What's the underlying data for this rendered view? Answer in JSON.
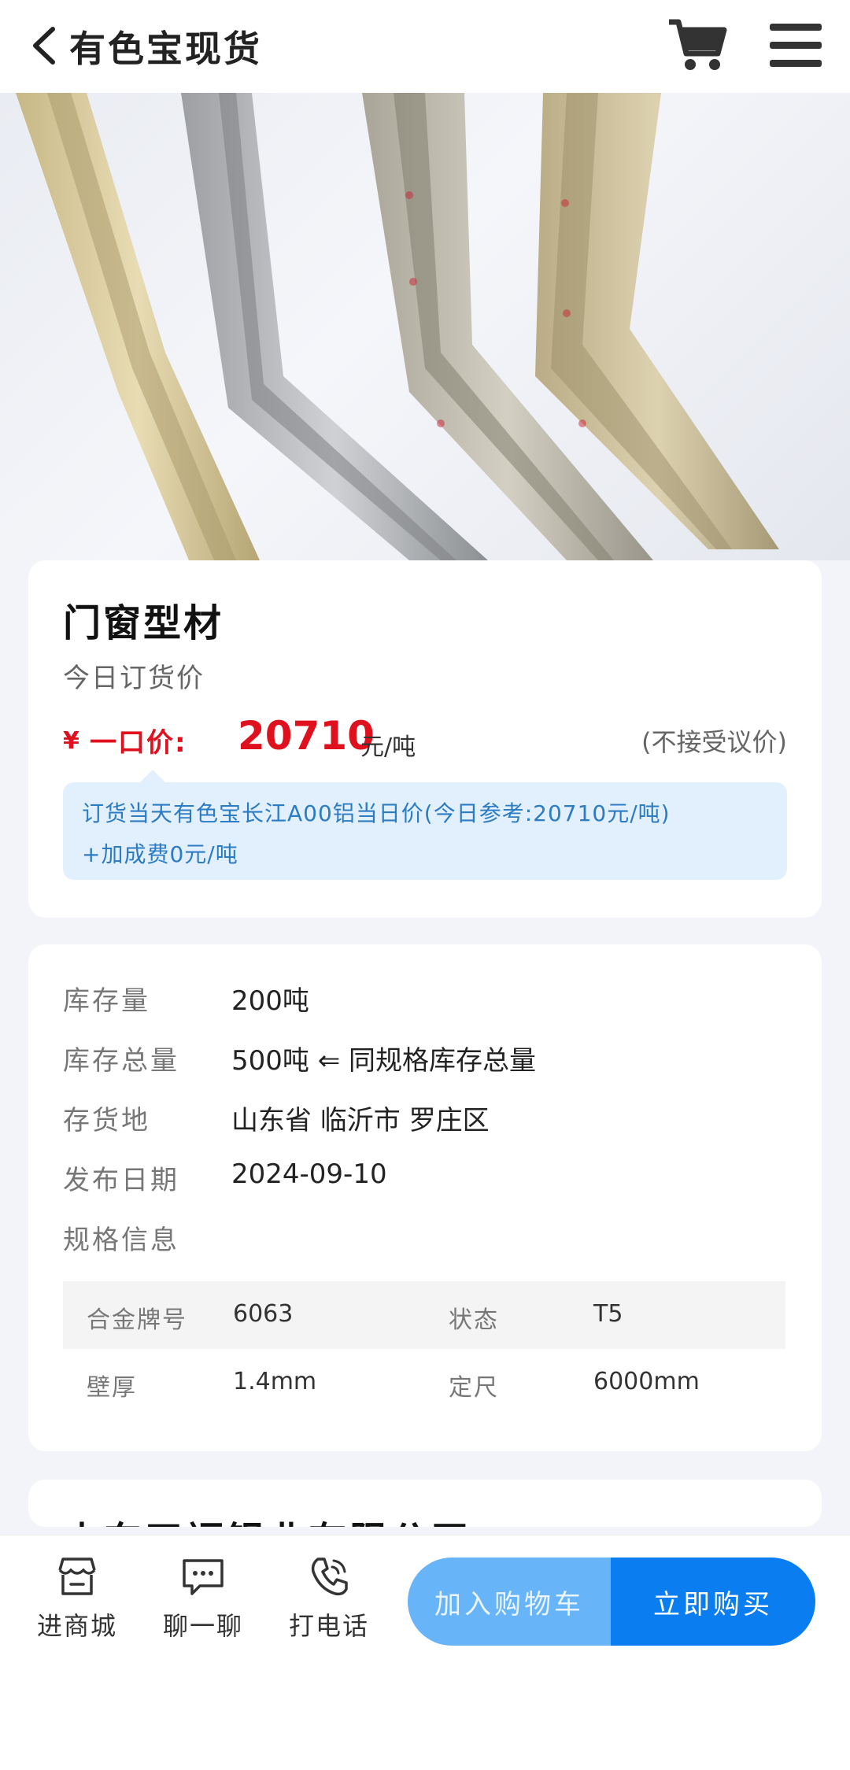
{
  "header": {
    "title": "有色宝现货"
  },
  "product": {
    "name": "门窗型材",
    "price_caption": "今日订货价",
    "currency": "¥",
    "price_label": "一口价:",
    "price_value": "20710",
    "price_unit": "元/吨",
    "bargain_note": "(不接受议价)",
    "formula_line1": "订货当天有色宝长江A00铝当日价(今日参考:20710元/吨)",
    "formula_line2": "+加成费0元/吨"
  },
  "details": {
    "rows": [
      {
        "label": "库存量",
        "value": "200吨"
      },
      {
        "label": "库存总量",
        "value": "500吨 ⇐ 同规格库存总量"
      },
      {
        "label": "存货地",
        "value": "山东省 临沂市 罗庄区"
      },
      {
        "label": "发布日期",
        "value": "2024-09-10"
      },
      {
        "label": "规格信息",
        "value": ""
      }
    ],
    "specs": [
      [
        {
          "k": "合金牌号",
          "v": "6063"
        },
        {
          "k": "状态",
          "v": "T5"
        }
      ],
      [
        {
          "k": "壁厚",
          "v": "1.4mm"
        },
        {
          "k": "定尺",
          "v": "6000mm"
        }
      ]
    ]
  },
  "company": {
    "partial_name": "山东天福铝业有限公司"
  },
  "bottom_bar": {
    "shop_label": "进商城",
    "chat_label": "聊一聊",
    "call_label": "打电话",
    "add_cart_label": "加入购物车",
    "buy_label": "立即购买"
  },
  "colors": {
    "price_red": "#e0111e",
    "primary_blue": "#0a7df0",
    "light_blue": "#67b4f8",
    "note_bg": "#e2effc"
  }
}
